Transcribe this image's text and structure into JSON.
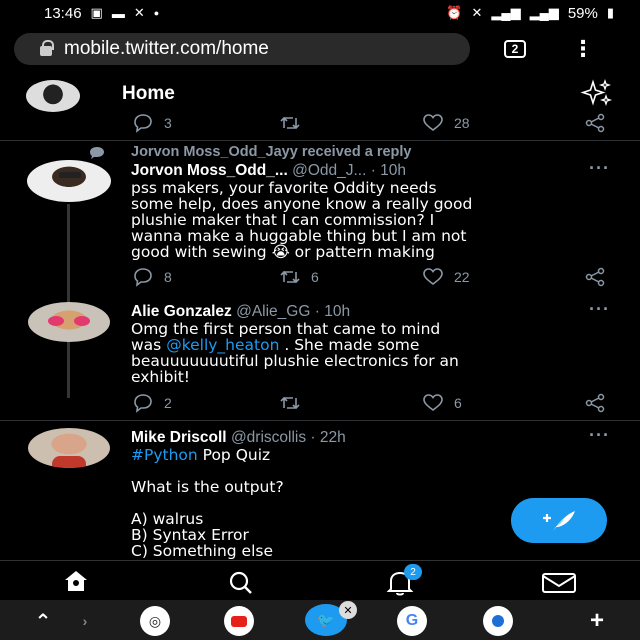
{
  "status_bar": {
    "time": "13:46",
    "battery": "59%"
  },
  "browser": {
    "url": "mobile.twitter.com/home",
    "tab_count": "2"
  },
  "header": {
    "title": "Home"
  },
  "top_actions": {
    "replies": "3",
    "likes": "28"
  },
  "tweets": [
    {
      "context": "Jorvon Moss_Odd_Jayy received a reply",
      "name": "Jorvon Moss_Odd_...",
      "handle": "@Odd_J...",
      "time": "· 10h",
      "lines": [
        "pss makers, your favorite Oddity needs",
        "some help, does anyone know a really good",
        "plushie maker that I can commission? I",
        "wanna make a huggable thing but I am not",
        "good with sewing 😭 or pattern making"
      ],
      "replies": "8",
      "retweets": "6",
      "likes": "22"
    },
    {
      "name": "Alie Gonzalez",
      "handle": "@Alie_GG",
      "time": "· 10h",
      "line1": "Omg the first person that came to mind",
      "line2_pre": "was ",
      "mention": "@kelly_heaton",
      "line2_post": " . She made some",
      "line3": "beauuuuuuutiful plushie electronics for an",
      "line4": "exhibit!",
      "replies": "2",
      "likes": "6"
    },
    {
      "name": "Mike Driscoll",
      "handle": "@driscollis",
      "time": "· 22h",
      "hashtag": "#Python",
      "line1_post": " Pop Quiz",
      "line2": "What is the output?",
      "option_a": "A) walrus",
      "option_b": "B) Syntax Error",
      "option_c": "C) Something else"
    }
  ],
  "nav": {
    "notification_count": "2"
  },
  "colors": {
    "accent": "#1d9bf0",
    "background": "#000000",
    "muted": "#8b98a5"
  }
}
